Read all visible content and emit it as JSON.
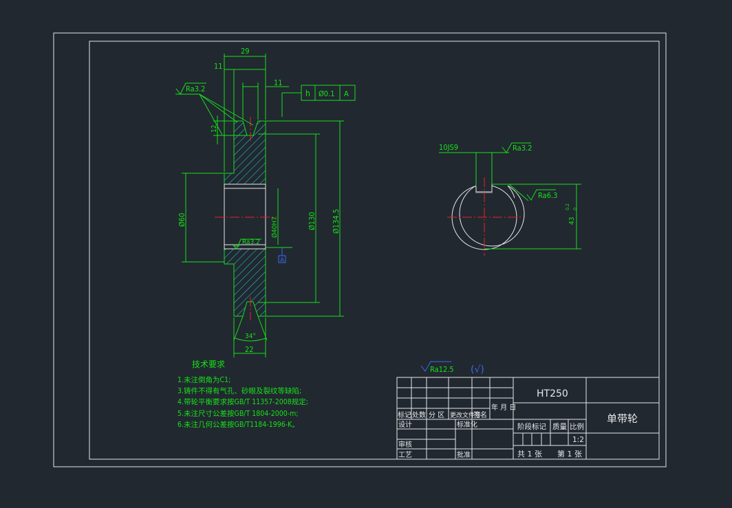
{
  "dims": {
    "d29": "29",
    "d11a": "11",
    "d11b": "11",
    "d12": "12",
    "d60": "Ø60",
    "d40h7": "Ø40H7",
    "d130": "Ø130",
    "d134": "Ø134.5",
    "d34deg": "34°",
    "d22": "22",
    "key_width": "10JS9",
    "key_depth": "43",
    "key_tol_up": "0.2",
    "key_tol_low": "0"
  },
  "roughness": {
    "r1": "Ra3.2",
    "r2": "Ra3.2",
    "r3": "Ra3.2",
    "r4": "Ra6.3",
    "general": "Ra12.5",
    "general_mark": "(√)"
  },
  "tolerance_frame": {
    "symbol": "h",
    "value": "Ø0.1",
    "datum": "A"
  },
  "datum_label": "A",
  "tech_requirements": {
    "title": "技术要求",
    "items": [
      "1.未注倒角为C1;",
      "3.铸件不得有气孔、砂眼及裂纹等缺陷;",
      "4.带轮平衡要求按GB/T 11357-2008规定;",
      "5.未注尺寸公差按GB/T 1804-2000-m;",
      "6.未注几何公差按GB/T1184-1996-K。"
    ]
  },
  "title_block": {
    "material": "HT250",
    "part_name": "单带轮",
    "col_biaoji": "标记",
    "col_chushu": "处数",
    "col_fenqu": "分 区",
    "col_gengai": "更改文件号",
    "col_qianming": "签名",
    "col_date": "年 月 日",
    "row_sheji": "设计",
    "row_biaozhunhua": "标准化",
    "row_shenhe": "审核",
    "row_gongyi": "工艺",
    "row_pizhun": "批准",
    "stage_mark": "阶段标记",
    "weight": "质量",
    "scale_label": "比例",
    "scale_value": "1:2",
    "sheets_total": "共 1 张",
    "sheet_no": "第 1 张"
  }
}
